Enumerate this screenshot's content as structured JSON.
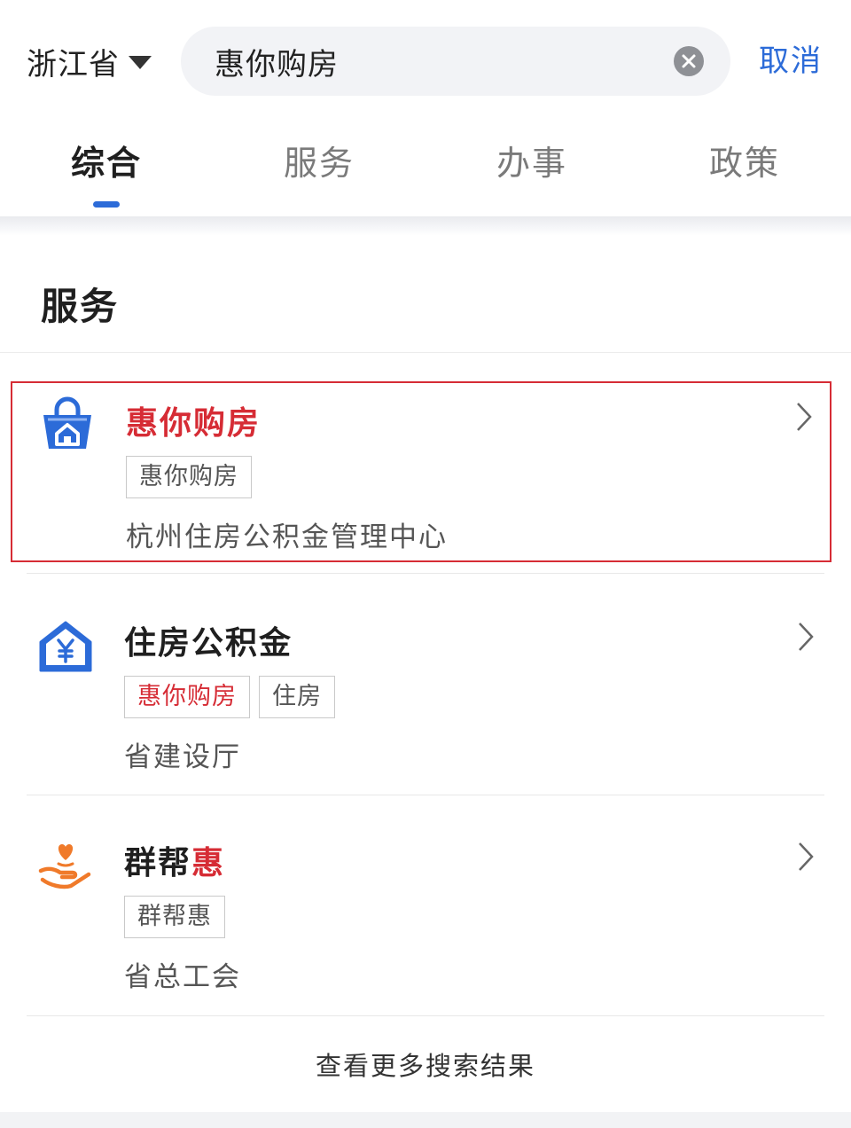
{
  "header": {
    "region": "浙江省",
    "search_value": "惠你购房",
    "cancel_label": "取消"
  },
  "tabs": [
    {
      "label": "综合",
      "active": true
    },
    {
      "label": "服务",
      "active": false
    },
    {
      "label": "办事",
      "active": false
    },
    {
      "label": "政策",
      "active": false
    }
  ],
  "section": {
    "title": "服务"
  },
  "results": [
    {
      "title": "惠你购房",
      "title_highlight": "惠你购房",
      "tags": [
        "惠你购房"
      ],
      "source": "杭州住房公积金管理中心",
      "icon": "home-bag-icon",
      "highlighted_card": true
    },
    {
      "title": "住房公积金",
      "title_highlight": "",
      "tags": [
        "惠你购房",
        "住房"
      ],
      "source": "省建设厅",
      "icon": "house-yuan-icon",
      "highlighted_card": false
    },
    {
      "title": "群帮惠",
      "title_prefix": "群帮",
      "title_highlight": "惠",
      "tags": [
        "群帮惠"
      ],
      "source": "省总工会",
      "icon": "hand-heart-icon",
      "highlighted_card": false
    }
  ],
  "more_results": "查看更多搜索结果",
  "colors": {
    "accent_blue": "#2c6bd8",
    "highlight_red": "#d62c35",
    "icon_orange": "#f07a2a"
  }
}
